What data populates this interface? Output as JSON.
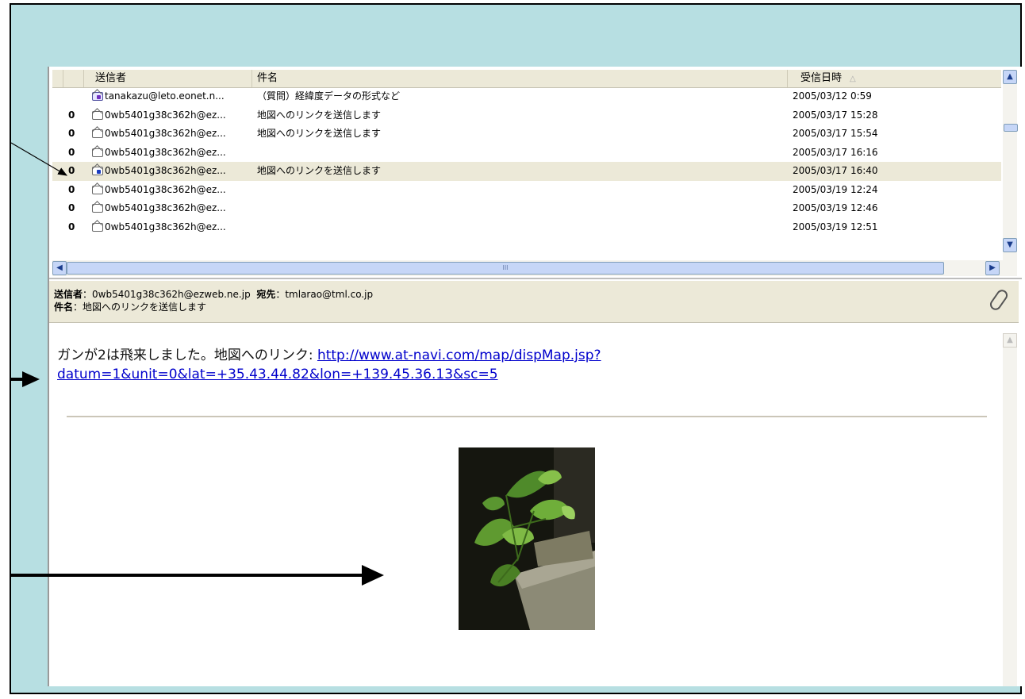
{
  "list": {
    "columns": {
      "from": "送信者",
      "subject": "件名",
      "date": "受信日時",
      "sort_mark": "△"
    },
    "rows": [
      {
        "attach": "",
        "from": "tanakazu@leto.eonet.n...",
        "subject": "（質問）経緯度データの形式など",
        "date": "2005/03/12 0:59",
        "status": "read"
      },
      {
        "attach": "0",
        "from": "0wb5401g38c362h@ez...",
        "subject": "地図へのリンクを送信します",
        "date": "2005/03/17 15:28",
        "status": "normal"
      },
      {
        "attach": "0",
        "from": "0wb5401g38c362h@ez...",
        "subject": "地図へのリンクを送信します",
        "date": "2005/03/17 15:54",
        "status": "normal"
      },
      {
        "attach": "0",
        "from": "0wb5401g38c362h@ez...",
        "subject": "",
        "date": "2005/03/17 16:16",
        "status": "normal"
      },
      {
        "attach": "0",
        "from": "0wb5401g38c362h@ez...",
        "subject": "地図へのリンクを送信します",
        "date": "2005/03/17 16:40",
        "status": "forwarded"
      },
      {
        "attach": "0",
        "from": "0wb5401g38c362h@ez...",
        "subject": "",
        "date": "2005/03/19 12:24",
        "status": "normal"
      },
      {
        "attach": "0",
        "from": "0wb5401g38c362h@ez...",
        "subject": "",
        "date": "2005/03/19 12:46",
        "status": "normal"
      },
      {
        "attach": "0",
        "from": "0wb5401g38c362h@ez...",
        "subject": "",
        "date": "2005/03/19 12:51",
        "status": "normal"
      }
    ],
    "selected_index": 4,
    "hscroll_grip": "III"
  },
  "preview": {
    "from_label": "送信者",
    "from_value": "：0wb5401g38c362h@ezweb.ne.jp",
    "to_label": "宛先",
    "to_value": "：tmlarao@tml.co.jp",
    "subject_label": "件名",
    "subject_value": "：地図へのリンクを送信します",
    "body_text": "ガンが2は飛来しました。地図へのリンク: ",
    "link_text": "http://www.at-navi.com/map/dispMap.jsp?datum=1&unit=0&lat=+35.43.44.82&lon=+139.45.36.13&sc=5"
  },
  "icons": [
    "paperclip-icon",
    "envelope-icon",
    "scroll-up-icon",
    "scroll-down-icon",
    "scroll-left-icon",
    "scroll-right-icon"
  ],
  "colors": {
    "background": "#b7dfe2",
    "selection": "#ece9d8",
    "link": "#0000cc",
    "scrollbar": "#c6d6f7"
  }
}
